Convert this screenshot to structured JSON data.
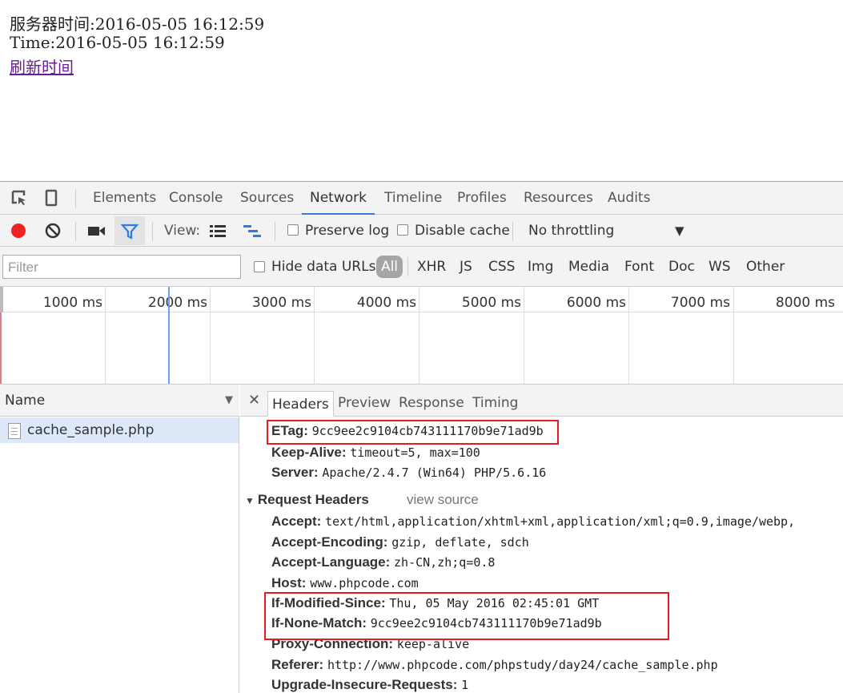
{
  "page": {
    "server_time": "服务器时间:2016-05-05 16:12:59",
    "time": "Time:2016-05-05 16:12:59",
    "refresh_link": "刷新时间"
  },
  "devtools": {
    "tabs": [
      "Elements",
      "Console",
      "Sources",
      "Network",
      "Timeline",
      "Profiles",
      "Resources",
      "Audits"
    ],
    "active_tab": "Network",
    "toolbar": {
      "view_label": "View:",
      "preserve_log": "Preserve log",
      "disable_cache": "Disable cache",
      "throttling": "No throttling"
    },
    "filter": {
      "placeholder": "Filter",
      "hide_data_urls": "Hide data URLs",
      "types": [
        "All",
        "XHR",
        "JS",
        "CSS",
        "Img",
        "Media",
        "Font",
        "Doc",
        "WS",
        "Other"
      ]
    },
    "timeline_labels": [
      "1000 ms",
      "2000 ms",
      "3000 ms",
      "4000 ms",
      "5000 ms",
      "6000 ms",
      "7000 ms",
      "8000 ms"
    ],
    "name_column": {
      "header": "Name",
      "files": [
        "cache_sample.php"
      ]
    },
    "detail_tabs": [
      "Headers",
      "Preview",
      "Response",
      "Timing"
    ],
    "response_headers": [
      {
        "name": "ETag:",
        "value": "9cc9ee2c9104cb743111170b9e71ad9b"
      },
      {
        "name": "Keep-Alive:",
        "value": "timeout=5, max=100"
      },
      {
        "name": "Server:",
        "value": "Apache/2.4.7 (Win64) PHP/5.6.16"
      }
    ],
    "request_section": {
      "title": "Request Headers",
      "view_source": "view source"
    },
    "request_headers": [
      {
        "name": "Accept:",
        "value": "text/html,application/xhtml+xml,application/xml;q=0.9,image/webp,"
      },
      {
        "name": "Accept-Encoding:",
        "value": "gzip, deflate, sdch"
      },
      {
        "name": "Accept-Language:",
        "value": "zh-CN,zh;q=0.8"
      },
      {
        "name": "Host:",
        "value": "www.phpcode.com"
      },
      {
        "name": "If-Modified-Since:",
        "value": "Thu, 05 May 2016 02:45:01 GMT"
      },
      {
        "name": "If-None-Match:",
        "value": "9cc9ee2c9104cb743111170b9e71ad9b"
      },
      {
        "name": "Proxy-Connection:",
        "value": "keep-alive"
      },
      {
        "name": "Referer:",
        "value": "http://www.phpcode.com/phpstudy/day24/cache_sample.php"
      },
      {
        "name": "Upgrade-Insecure-Requests:",
        "value": "1"
      }
    ],
    "colors": {
      "record": "#e22",
      "highlight_box": "#e51c23",
      "active_tab_underline": "#3879d9",
      "filter_icon": "#2a7de1"
    }
  }
}
